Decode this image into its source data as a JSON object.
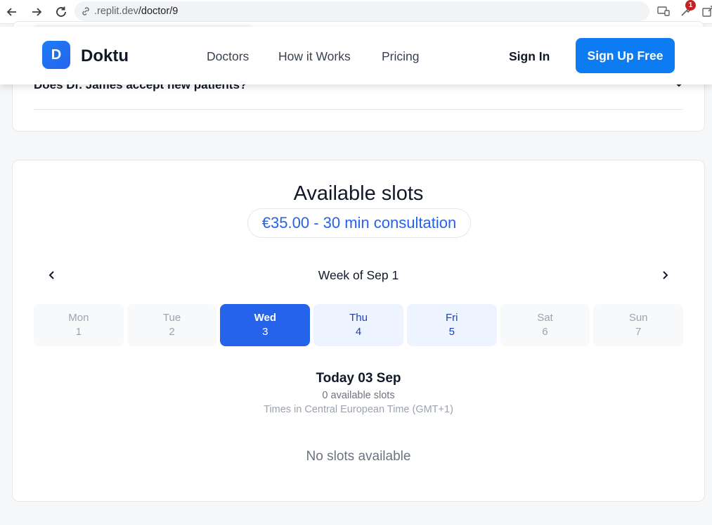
{
  "browser": {
    "url_host": ".replit.dev",
    "url_path": "/doctor/9",
    "extension_badge": "1"
  },
  "faq": {
    "question": "Does Dr. James accept new patients?"
  },
  "header": {
    "logo_letter": "D",
    "brand": "Doktu",
    "nav": [
      "Doctors",
      "How it Works",
      "Pricing"
    ],
    "sign_in": "Sign In",
    "sign_up": "Sign Up Free"
  },
  "slots": {
    "title": "Available slots",
    "price": "€35.00 - 30 min consultation",
    "week_label": "Week of Sep 1",
    "days": [
      {
        "name": "Mon",
        "num": "1",
        "state": "disabled"
      },
      {
        "name": "Tue",
        "num": "2",
        "state": "disabled"
      },
      {
        "name": "Wed",
        "num": "3",
        "state": "selected"
      },
      {
        "name": "Thu",
        "num": "4",
        "state": "available"
      },
      {
        "name": "Fri",
        "num": "5",
        "state": "available"
      },
      {
        "name": "Sat",
        "num": "6",
        "state": "disabled"
      },
      {
        "name": "Sun",
        "num": "7",
        "state": "disabled"
      }
    ],
    "today_title": "Today 03 Sep",
    "today_count": "0 available slots",
    "timezone": "Times in Central European Time (GMT+1)",
    "empty": "No slots available"
  },
  "colors": {
    "primary": "#2563eb",
    "signup": "#0d7cf2",
    "badge": "#c5221f"
  }
}
